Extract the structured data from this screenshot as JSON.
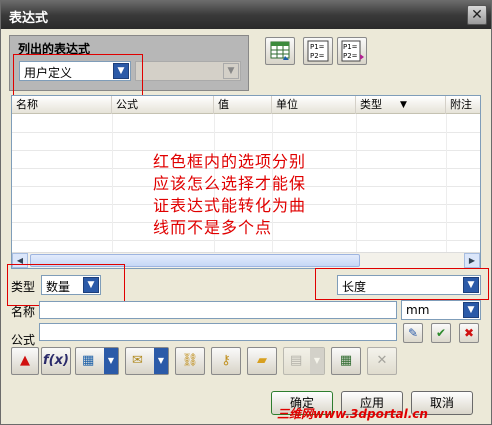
{
  "window": {
    "title": "表达式",
    "close_glyph": "✕"
  },
  "list_group": {
    "title": "列出的表达式",
    "filter_value": "用户定义",
    "secondary_value": ""
  },
  "table": {
    "columns": [
      "名称",
      "公式",
      "值",
      "单位",
      "类型",
      "附注"
    ],
    "sort_indicator": "▼",
    "rows": []
  },
  "annotation": {
    "lines": [
      "红色框内的选项分别",
      "应该怎么选择才能保",
      "证表达式能转化为曲",
      "线而不是多个点"
    ],
    "color": "#e00000"
  },
  "type_row": {
    "label": "类型",
    "type_value": "数量",
    "dimension_value": "长度"
  },
  "name_row": {
    "label": "名称",
    "name_value": "",
    "unit_value": "mm"
  },
  "formula_row": {
    "label": "公式",
    "formula_value": ""
  },
  "buttons": {
    "ok": "确定",
    "apply": "应用",
    "cancel": "取消"
  },
  "watermark": "三维网www.3dportal.cn",
  "icons": {
    "spreadsheet": "spreadsheet-icon",
    "p1p2_list": "p1-p2-list-icon",
    "p1p2_play": "p1-p2-play-icon"
  },
  "colors": {
    "title_bg": "#3a3a3a",
    "accent": "#2b5aa8",
    "highlight_box": "#e00000"
  }
}
